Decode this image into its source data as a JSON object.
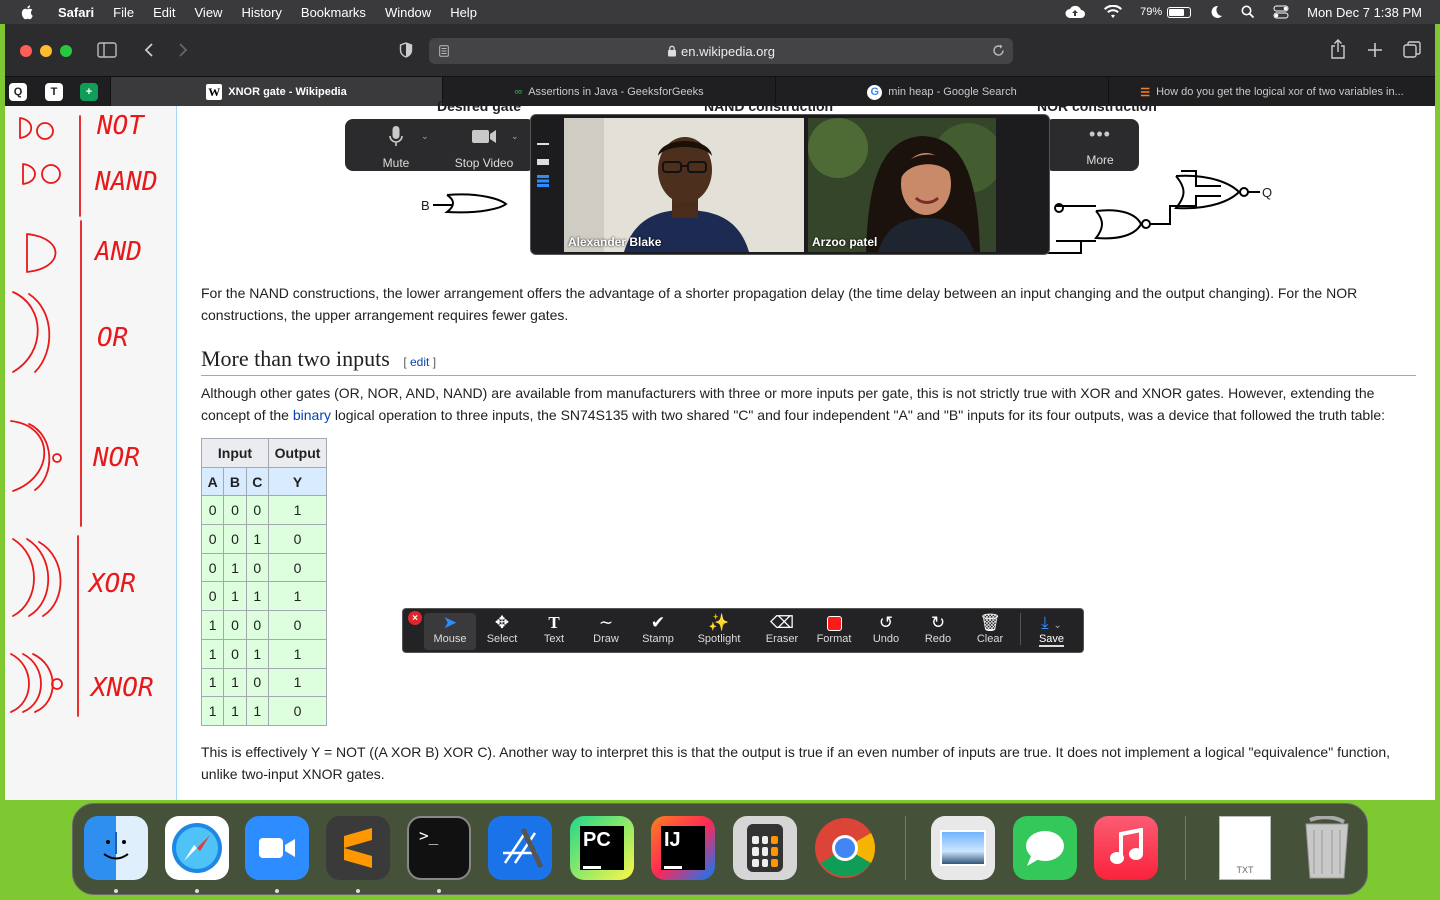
{
  "menubar": {
    "app": "Safari",
    "items": [
      "File",
      "Edit",
      "View",
      "History",
      "Bookmarks",
      "Window",
      "Help"
    ],
    "battery": "79%",
    "clock": "Mon Dec 7  1:38 PM"
  },
  "browser": {
    "url": "en.wikipedia.org",
    "tabs": [
      {
        "title": "XNOR gate - Wikipedia",
        "active": true
      },
      {
        "title": "Assertions in Java - GeeksforGeeks",
        "active": false
      },
      {
        "title": "min heap - Google Search",
        "active": false
      },
      {
        "title": "How do you get the logical xor of two variables in...",
        "active": false
      }
    ]
  },
  "article": {
    "top_headers": [
      "Desired gate",
      "NAND construction",
      "NOR construction"
    ],
    "diagram_labels": {
      "b": "B",
      "q": "Q"
    },
    "para1": "For the NAND constructions, the lower arrangement offers the advantage of a shorter propagation delay (the time delay between an input changing and the output changing). For the NOR constructions, the upper arrangement requires fewer gates.",
    "section_title": "More than two inputs",
    "edit_link": "edit",
    "para2_before": "Although other gates (OR, NOR, AND, NAND) are available from manufacturers with three or more inputs per gate, this is not strictly true with XOR and XNOR gates. However, extending the concept of the ",
    "para2_link": "binary",
    "para2_after": " logical operation to three inputs, the SN74S135 with two shared \"C\" and four independent \"A\" and \"B\" inputs for its four outputs, was a device that followed the truth table:",
    "truth_table": {
      "group_headers": [
        "Input",
        "Output"
      ],
      "column_headers": [
        "A",
        "B",
        "C",
        "Y"
      ],
      "rows": [
        [
          "0",
          "0",
          "0",
          "1"
        ],
        [
          "0",
          "0",
          "1",
          "0"
        ],
        [
          "0",
          "1",
          "0",
          "0"
        ],
        [
          "0",
          "1",
          "1",
          "1"
        ],
        [
          "1",
          "0",
          "0",
          "0"
        ],
        [
          "1",
          "0",
          "1",
          "1"
        ],
        [
          "1",
          "1",
          "0",
          "1"
        ],
        [
          "1",
          "1",
          "1",
          "0"
        ]
      ]
    },
    "para3": "This is effectively Y = NOT ((A XOR B) XOR C). Another way to interpret this is that the output is true if an even number of inputs are true. It does not implement a logical \"equivalence\" function, unlike two-input XNOR gates."
  },
  "sidebar_annotations": [
    "NOT",
    "NAND",
    "AND",
    "OR",
    "NOR",
    "XOR",
    "XNOR"
  ],
  "zoom": {
    "mute_label": "Mute",
    "video_label": "Stop Video",
    "more_label": "More",
    "participants": [
      "Alexander Blake",
      "Arzoo patel"
    ]
  },
  "annotate_toolbar": {
    "tools": [
      "Mouse",
      "Select",
      "Text",
      "Draw",
      "Stamp",
      "Spotlight",
      "Eraser",
      "Format",
      "Undo",
      "Redo",
      "Clear",
      "Save"
    ],
    "format_color": "#ff1a1a"
  },
  "dock": {
    "apps": [
      "Finder",
      "Safari",
      "Zoom",
      "Sublime Text",
      "Terminal",
      "Xcode",
      "PyCharm",
      "IntelliJ IDEA",
      "Calculator",
      "Google Chrome",
      "Preview",
      "Messages",
      "Music",
      "TXT File",
      "Trash"
    ],
    "file_label": "TXT"
  }
}
